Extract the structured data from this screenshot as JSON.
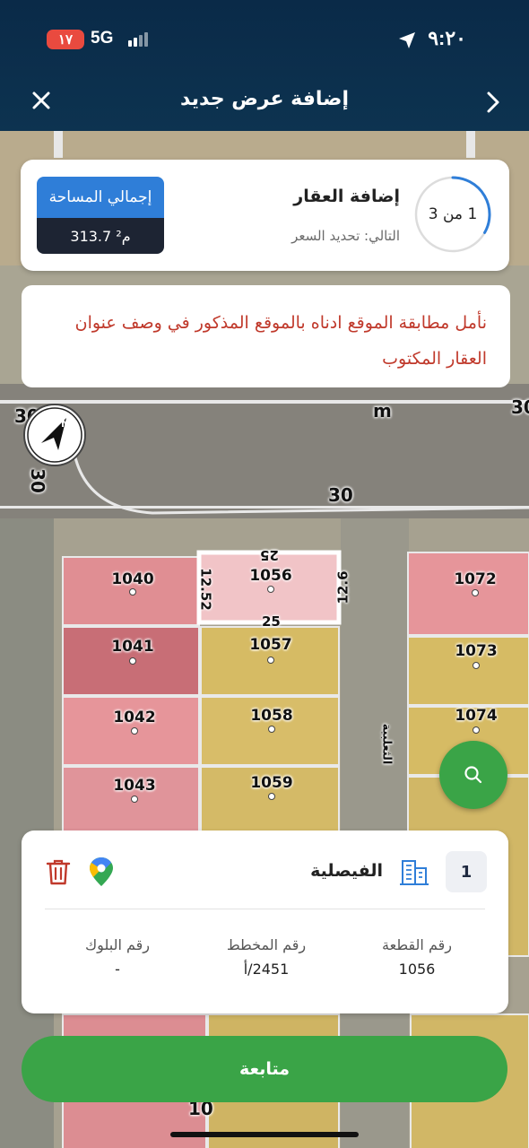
{
  "status_bar": {
    "time": "٩:٢٠",
    "battery": "١٧",
    "network": "5G"
  },
  "header": {
    "title": "إضافة عرض جديد",
    "close_icon": "close-icon",
    "back_icon": "chevron-right-icon"
  },
  "step": {
    "progress": "1 من 3",
    "progress_fraction": 0.333,
    "title": "إضافة العقار",
    "next": "التالي: تحديد السعر",
    "area_label": "إجمالي المساحة",
    "area_value": "313.7 م²"
  },
  "notice": {
    "text": "نأمل مطابقة الموقع ادناه بالموقع المذكور في وصف عنوان العقار المكتوب"
  },
  "map": {
    "street_labels": [
      "30",
      "30",
      "30",
      "30",
      "10"
    ],
    "street_marker": "m",
    "street_name": "الثعلبية",
    "selected_plot": "1056",
    "plots": [
      "1040",
      "1041",
      "1042",
      "1043",
      "1056",
      "1057",
      "1058",
      "1059",
      "1072",
      "1073",
      "1074"
    ],
    "dimensions": [
      "25",
      "25",
      "12.52",
      "12.6"
    ],
    "colors": {
      "pink_plot": "#e69196",
      "yellow_plot": "#d9c06c",
      "selected": "#f3c9cb"
    }
  },
  "info": {
    "index": "1",
    "district": "الفيصلية",
    "columns": [
      {
        "label": "رقم القطعة",
        "value": "1056"
      },
      {
        "label": "رقم المخطط",
        "value": "2451/أ"
      },
      {
        "label": "رقم البلوك",
        "value": "-"
      }
    ]
  },
  "actions": {
    "continue_label": "متابعة"
  },
  "theme": {
    "header_bg": "#0d3350",
    "accent_green": "#3aa447",
    "accent_blue": "#2f7ed8",
    "notice_red": "#c0392b"
  }
}
